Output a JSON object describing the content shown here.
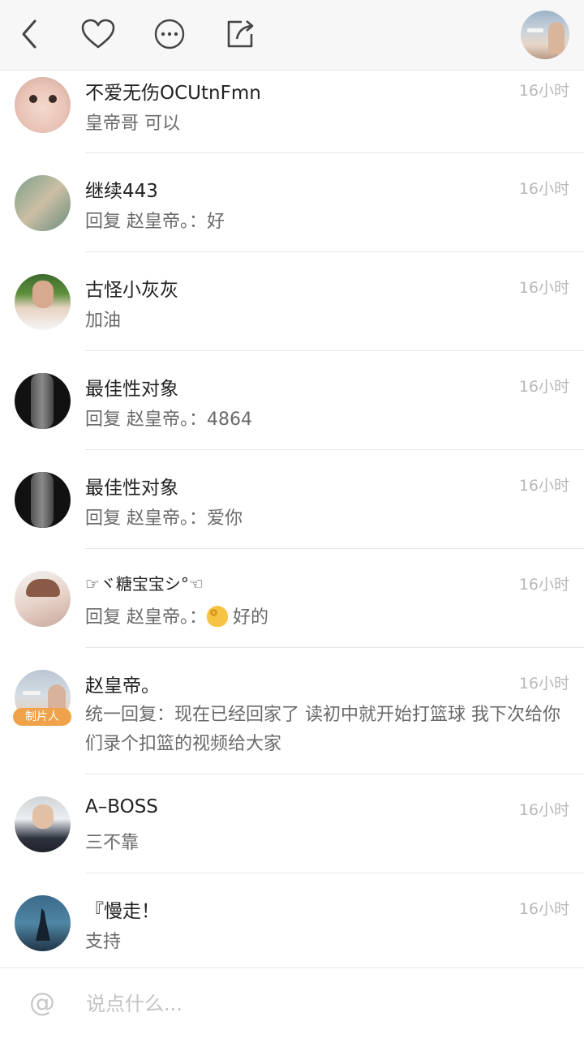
{
  "top_bar": {
    "back_icon": "chevron-left-icon",
    "like_icon": "heart-icon",
    "more_icon": "more-dots-icon",
    "share_icon": "share-icon"
  },
  "comments": [
    {
      "name": "不爱无伤OCUtnFmn",
      "time": "16小时",
      "content": "皇帝哥 可以"
    },
    {
      "name": "继续443",
      "time": "16小时",
      "content": "回复 赵皇帝。：好"
    },
    {
      "name": "古怪小灰灰",
      "time": "16小时",
      "content": "加油"
    },
    {
      "name": "最佳性对象",
      "time": "16小时",
      "content": "回复 赵皇帝。：4864"
    },
    {
      "name": "最佳性对象",
      "time": "16小时",
      "content": "回复 赵皇帝。：爱你"
    },
    {
      "name": "☞ヾ糖宝宝シ°☜",
      "time": "16小时",
      "content_prefix": "回复 赵皇帝。：",
      "content_suffix": "好的"
    },
    {
      "name": "赵皇帝。",
      "time": "16小时",
      "badge": "制片人",
      "content": "统一回复：现在已经回家了 读初中就开始打篮球 我下次给你们录个扣篮的视频给大家"
    },
    {
      "name": "A–BOSS",
      "time": "16小时",
      "content": "三不靠"
    },
    {
      "name": "『慢走！",
      "time": "16小时",
      "content": "支持"
    }
  ],
  "input_bar": {
    "at_symbol": "@",
    "placeholder": "说点什么..."
  }
}
